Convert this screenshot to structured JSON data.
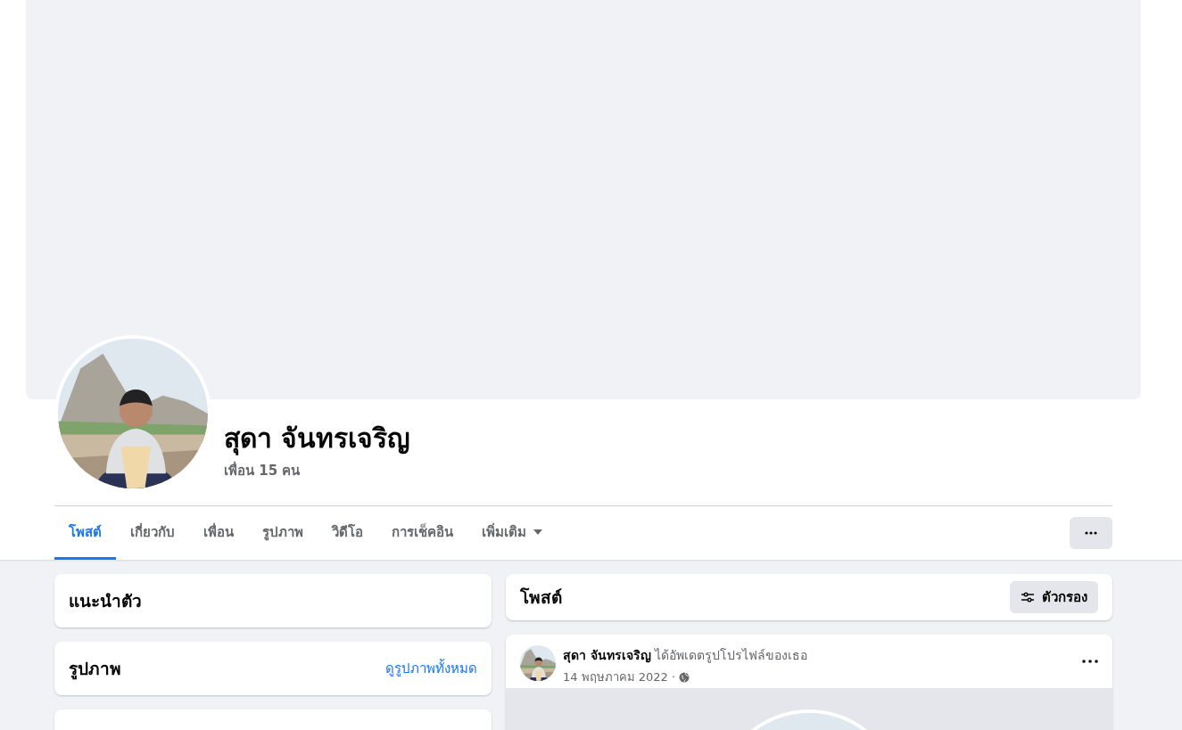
{
  "profile": {
    "name": "สุดา จันทรเจริญ",
    "friends": "เพื่อน 15 คน"
  },
  "tabs": [
    {
      "label": "โพสต์",
      "selected": true,
      "kind": "link"
    },
    {
      "label": "เกี่ยวกับ",
      "selected": false,
      "kind": "link"
    },
    {
      "label": "เพื่อน",
      "selected": false,
      "kind": "link"
    },
    {
      "label": "รูปภาพ",
      "selected": false,
      "kind": "link"
    },
    {
      "label": "วิดีโอ",
      "selected": false,
      "kind": "link"
    },
    {
      "label": "การเช็คอิน",
      "selected": false,
      "kind": "link"
    },
    {
      "label": "เพิ่มเติม",
      "selected": false,
      "kind": "dropdown"
    }
  ],
  "sidebar": {
    "cards": [
      {
        "title": "แนะนำตัว"
      },
      {
        "title": "รูปภาพ",
        "link": "ดูรูปภาพทั้งหมด"
      }
    ]
  },
  "posts": {
    "title": "โพสต์",
    "filter_button": "ตัวกรอง"
  },
  "post": {
    "headline": "**สุดา จันทรเจริญ** ได้อัพเดตรูปโปรไฟล์ของเธอ",
    "date": "14 พฤษภาคม 2022 ·"
  }
}
